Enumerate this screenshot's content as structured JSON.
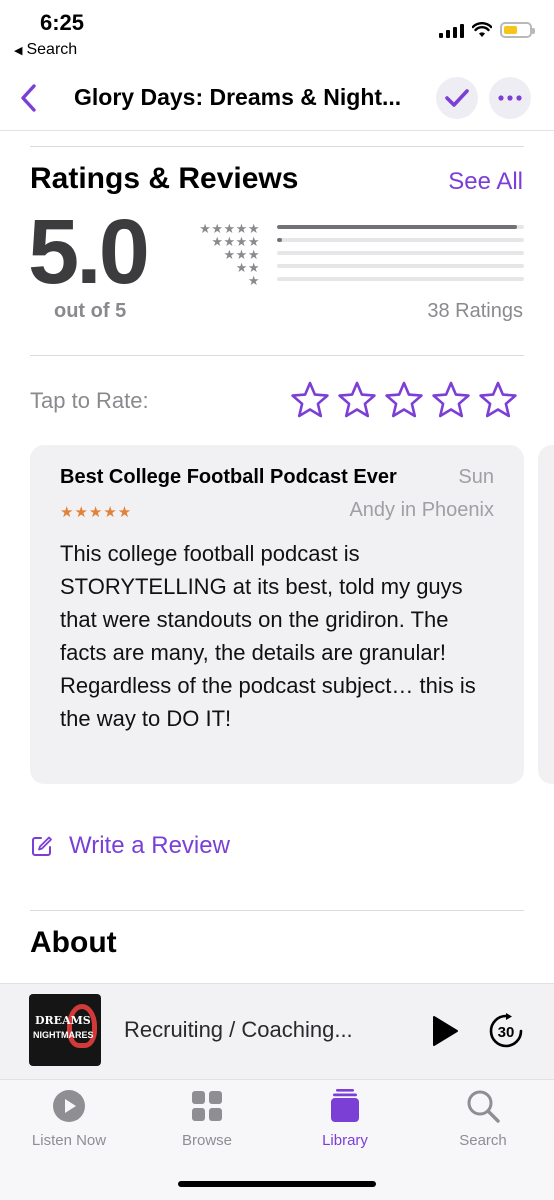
{
  "status_bar": {
    "time": "6:25",
    "back_label": "Search"
  },
  "nav": {
    "title": "Glory Days: Dreams & Night..."
  },
  "ratings": {
    "heading": "Ratings & Reviews",
    "see_all": "See All",
    "average": "5.0",
    "out_of": "out of 5",
    "count_label": "38 Ratings",
    "distribution": [
      {
        "stars": 5,
        "fraction": 0.97
      },
      {
        "stars": 4,
        "fraction": 0.02
      },
      {
        "stars": 3,
        "fraction": 0
      },
      {
        "stars": 2,
        "fraction": 0
      },
      {
        "stars": 1,
        "fraction": 0
      }
    ]
  },
  "tap_to_rate": {
    "label": "Tap to Rate:",
    "max_stars": 5
  },
  "review": {
    "title": "Best College Football Podcast Ever",
    "date": "Sun",
    "rating": 5,
    "author": "Andy in Phoenix",
    "body": "This college football podcast is STORYTELLING at its best, told my guys that were standouts on the gridiron. The facts are many, the details are granular!\nRegardless of the podcast subject… this is the way to DO IT!"
  },
  "write_review": {
    "label": "Write a Review"
  },
  "about": {
    "heading": "About"
  },
  "mini_player": {
    "episode_title": "Recruiting / Coaching...",
    "skip_seconds": "30",
    "artwork_text_1": "DREAMS",
    "artwork_text_2": "NIGHTMARES"
  },
  "tabs": [
    {
      "label": "Listen Now",
      "icon": "play-circle-icon",
      "active": false
    },
    {
      "label": "Browse",
      "icon": "grid-icon",
      "active": false
    },
    {
      "label": "Library",
      "icon": "library-icon",
      "active": true
    },
    {
      "label": "Search",
      "icon": "search-icon",
      "active": false
    }
  ],
  "colors": {
    "accent": "#7b3fd6",
    "review_stars": "#e0823a",
    "secondary_text": "#8a8a8e"
  }
}
